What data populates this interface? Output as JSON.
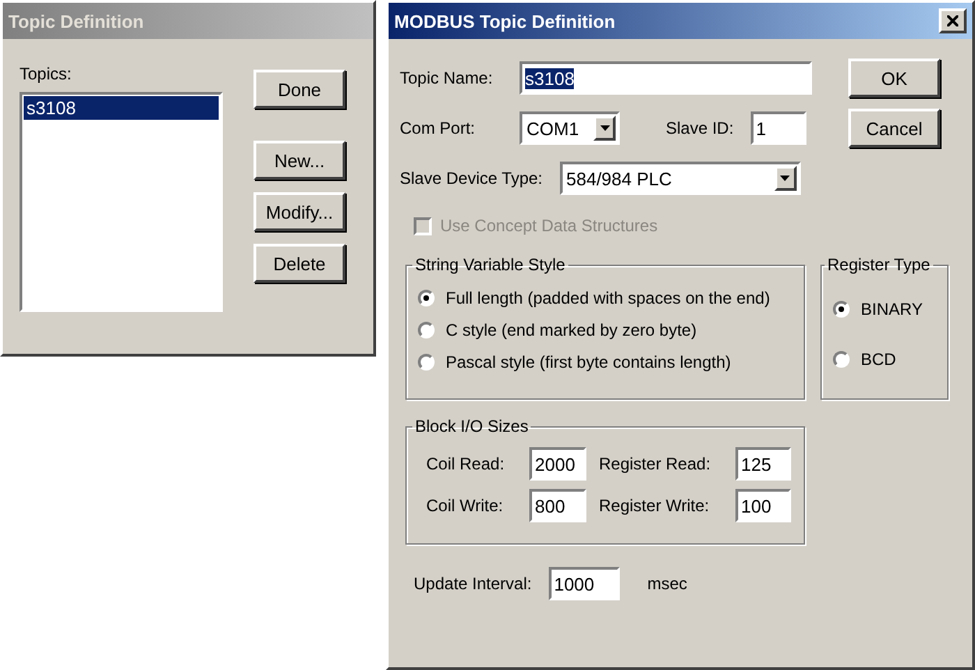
{
  "topic_window": {
    "title": "Topic Definition",
    "active": false,
    "topics_label": "Topics:",
    "topics": [
      {
        "name": "s3108",
        "selected": true
      }
    ],
    "buttons": [
      "Done",
      "New...",
      "Modify...",
      "Delete"
    ]
  },
  "modbus_window": {
    "title": "MODBUS Topic Definition",
    "active": true,
    "topic_name": {
      "label": "Topic Name:",
      "value": "s3108",
      "text_selected": true
    },
    "com_port": {
      "label": "Com Port:",
      "value": "COM1"
    },
    "slave_id": {
      "label": "Slave ID:",
      "value": "1"
    },
    "slave_device_type": {
      "label": "Slave Device Type:",
      "value": "584/984 PLC"
    },
    "concept_checkbox": {
      "label": "Use Concept Data Structures",
      "checked": false,
      "disabled": true
    },
    "string_style": {
      "title": "String Variable Style",
      "options": [
        {
          "label": "Full length (padded with spaces on the end)",
          "selected": true
        },
        {
          "label": "C style (end marked by zero byte)",
          "selected": false
        },
        {
          "label": "Pascal style (first byte contains length)",
          "selected": false
        }
      ]
    },
    "register_type": {
      "title": "Register Type",
      "options": [
        {
          "label": "BINARY",
          "selected": true
        },
        {
          "label": "BCD",
          "selected": false
        }
      ]
    },
    "block_io": {
      "title": "Block I/O Sizes",
      "fields": [
        {
          "label": "Coil Read:",
          "value": "2000"
        },
        {
          "label": "Register Read:",
          "value": "125"
        },
        {
          "label": "Coil Write:",
          "value": "800"
        },
        {
          "label": "Register Write:",
          "value": "100"
        }
      ]
    },
    "update_interval": {
      "label": "Update Interval:",
      "value": "1000",
      "unit": "msec"
    },
    "buttons": [
      "OK",
      "Cancel"
    ]
  }
}
